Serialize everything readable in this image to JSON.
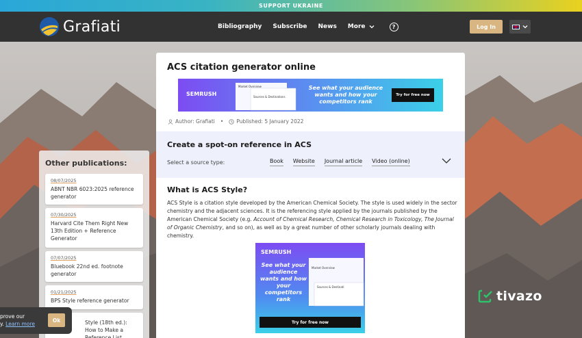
{
  "support_banner": "SUPPORT UKRAINE",
  "header": {
    "logo_text": "Grafiati",
    "nav": [
      "Bibliography",
      "Subscribe",
      "News",
      "More"
    ],
    "help_glyph": "?",
    "login_label": "Log In",
    "language_icon": "uk-flag-icon"
  },
  "article": {
    "title": "ACS citation generator online",
    "author": "Author: Grafiati",
    "published": "Published: 5 January 2022",
    "ad_banner": {
      "brand": "SEMRUSH",
      "headline": "See what your audience wants and how your competitors rank",
      "cta": "Try for free now",
      "panel_title": "Market Overview",
      "panel_sub": "Sources & Destinations"
    },
    "reference": {
      "title": "Create a spot-on reference in ACS",
      "source_label": "Select a source type:",
      "sources": [
        "Book",
        "Website",
        "Journal article",
        "Video (online)"
      ]
    },
    "section_title": "What is ACS Style?",
    "body": {
      "p1": "ACS Style is a citation style developed by the American Chemical Society. The style is used widely in the sector chemistry and the adjacent sciences. It is the referencing style applied by the journals published by the American Chemical Society (e.g. ",
      "i1": "Account of Chemical Research, Chemical Research in Toxicology, The Journal of Organic Chemistry",
      "p2": ", and so on), as well as by a great number of other scholarly journals dealing with chemistry."
    },
    "ad_square": {
      "brand": "SEMRUSH",
      "headline": "See what your audience wants and how your competitors rank",
      "cta": "Try for free now",
      "panel_title": "Market Overview",
      "panel_sub": "Sources & Destinati"
    }
  },
  "sidebar": {
    "title": "Other publications:",
    "items": [
      {
        "date": "08/07/2025",
        "title": "ABNT NBR 6023:2025 reference generator"
      },
      {
        "date": "07/30/2025",
        "title": "Harvard Cite Them Right New 13th Edition + Reference Generator"
      },
      {
        "date": "07/07/2025",
        "title": "Bluebook 22nd ed. footnote generator"
      },
      {
        "date": "01/21/2025",
        "title": "BPS Style reference generator"
      },
      {
        "date": "",
        "title": "Style (18th ed.): How to Make a Reference List"
      }
    ]
  },
  "cookie": {
    "text_line1": "prove our",
    "text_line2": "y.",
    "link": "Learn more",
    "ok": "Ok"
  },
  "watermark": "tivazo",
  "colors": {
    "header_bg": "#323232",
    "accent_gold": "#d9b681",
    "panel_bg": "#eef0fb",
    "ad_purple": "#8a4cf0"
  }
}
